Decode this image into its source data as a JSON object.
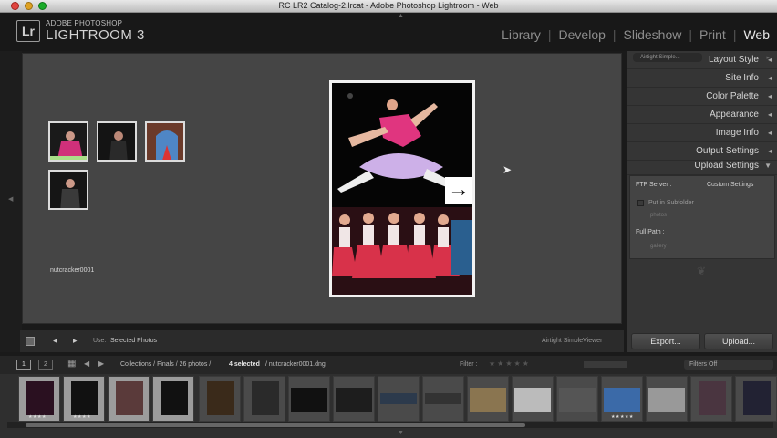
{
  "window": {
    "title": "RC LR2 Catalog-2.lrcat - Adobe Photoshop Lightroom - Web"
  },
  "brand": {
    "badge": "Lr",
    "company": "ADOBE PHOTOSHOP",
    "product": "LIGHTROOM 3"
  },
  "modules": [
    "Library",
    "Develop",
    "Slideshow",
    "Print",
    "Web"
  ],
  "active_module": "Web",
  "preview": {
    "caption": "nutcracker0001"
  },
  "right_panel": {
    "template": "Airtight Simple...",
    "sections": [
      "Layout Style",
      "Site Info",
      "Color Palette",
      "Appearance",
      "Image Info",
      "Output Settings",
      "Upload Settings"
    ],
    "ftp_label": "FTP Server :",
    "ftp_value": "Custom Settings",
    "subfolder_label": "Put in Subfolder",
    "subfolder_value": "photos",
    "fullpath_label": "Full Path :",
    "fullpath_value": "gallery",
    "export_label": "Export...",
    "upload_label": "Upload..."
  },
  "toolbar": {
    "use_label": "Use:",
    "use_value": "Selected Photos",
    "template_name": "Airtight SimpleViewer"
  },
  "filmstrip_bar": {
    "page1": "1",
    "page2": "2",
    "path": "Collections / Finals / 26 photos /",
    "selected": "4 selected",
    "file": "/ nutcracker0001.dng",
    "filter_label": "Filter :",
    "filters_off": "Filters Off"
  },
  "filmstrip": {
    "cells": 17,
    "selected_count": 4
  },
  "colors": {
    "panel": "#353535",
    "center": "#454545",
    "accent": "#e8e8e8"
  }
}
